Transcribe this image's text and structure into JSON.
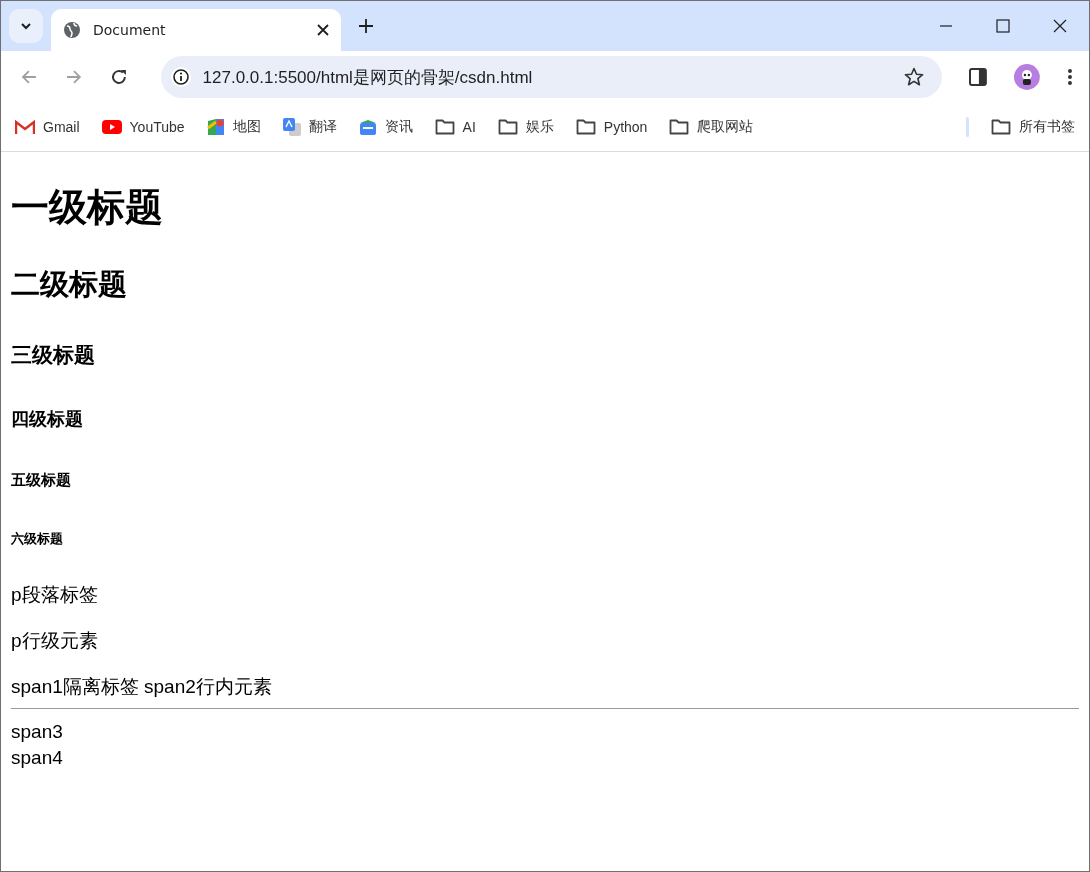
{
  "tabs": [
    {
      "title": "Document",
      "selected": true
    }
  ],
  "address": "127.0.0.1:5500/html是网页的骨架/csdn.html",
  "bookmarks": [
    {
      "label": "Gmail",
      "kind": "gmail"
    },
    {
      "label": "YouTube",
      "kind": "youtube"
    },
    {
      "label": "地图",
      "kind": "maps"
    },
    {
      "label": "翻译",
      "kind": "translate"
    },
    {
      "label": "资讯",
      "kind": "news"
    },
    {
      "label": "AI",
      "kind": "folder"
    },
    {
      "label": "娱乐",
      "kind": "folder"
    },
    {
      "label": "Python",
      "kind": "folder"
    },
    {
      "label": "爬取网站",
      "kind": "folder"
    }
  ],
  "all_bookmarks": "所有书签",
  "content": [
    {
      "kind": "h1",
      "text": "一级标题"
    },
    {
      "kind": "h2",
      "text": "二级标题"
    },
    {
      "kind": "h3",
      "text": "三级标题"
    },
    {
      "kind": "h4",
      "text": "四级标题"
    },
    {
      "kind": "h5",
      "text": "五级标题"
    },
    {
      "kind": "h6",
      "text": "六级标题"
    },
    {
      "kind": "p",
      "text": "p段落标签"
    },
    {
      "kind": "p",
      "text": "p行级元素"
    },
    {
      "kind": "p",
      "text": "span1隔离标签 span2行内元素"
    },
    {
      "kind": "hr"
    },
    {
      "kind": "line",
      "text": "span3"
    },
    {
      "kind": "line",
      "text": "span4"
    }
  ]
}
